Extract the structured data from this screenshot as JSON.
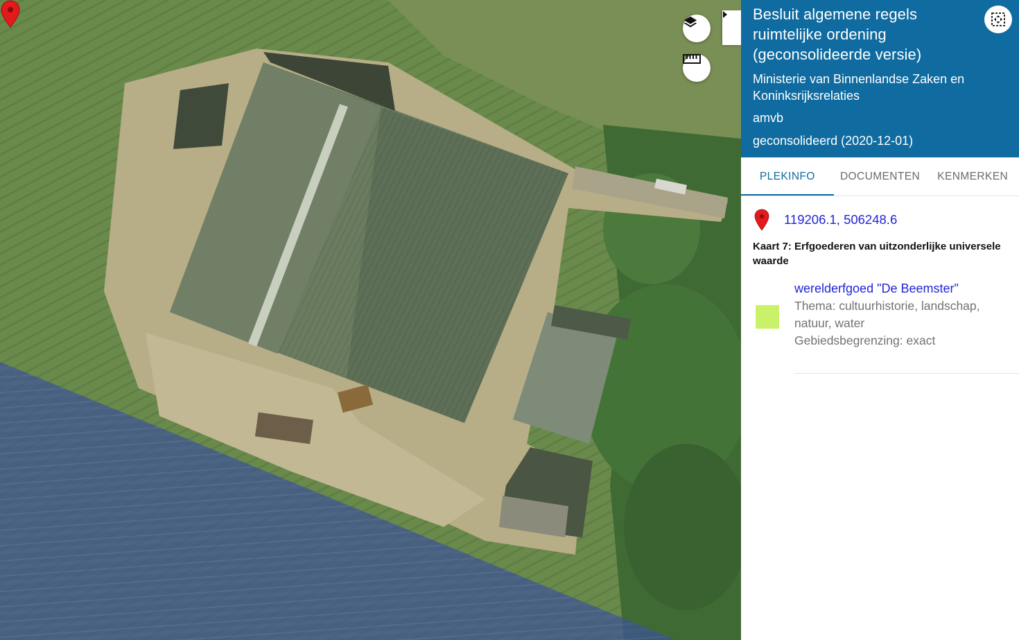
{
  "panel": {
    "title": "Besluit algemene regels ruimtelijke ordening (geconsolideerde versie)",
    "authority": "Ministerie van Binnenlandse Zaken en Koninksrijksrelaties",
    "doc_type": "amvb",
    "status": "geconsolideerd (2020-12-01)",
    "tabs": [
      {
        "label": "PLEKINFO",
        "active": true
      },
      {
        "label": "DOCUMENTEN",
        "active": false
      },
      {
        "label": "KENMERKEN",
        "active": false
      }
    ],
    "location": {
      "coordinates": "119206.1, 506248.6"
    },
    "map_title": "Kaart 7: Erfgoederen van uitzonderlijke universele waarde",
    "legend_item": {
      "name": "werelderfgoed \"De Beemster\"",
      "theme": "Thema: cultuurhistorie, landschap, natuur, water",
      "boundary": "Gebiedsbegrenzing: exact",
      "swatch_color": "#c9f26a"
    }
  },
  "map": {
    "controls": [
      "layers-icon",
      "ruler-icon",
      "chevron-right-icon"
    ],
    "overlay_color": "#2b44a8",
    "marker_color": "#e3191c"
  },
  "colors": {
    "header_bg": "#0f6ba0",
    "link": "#2323d9"
  }
}
